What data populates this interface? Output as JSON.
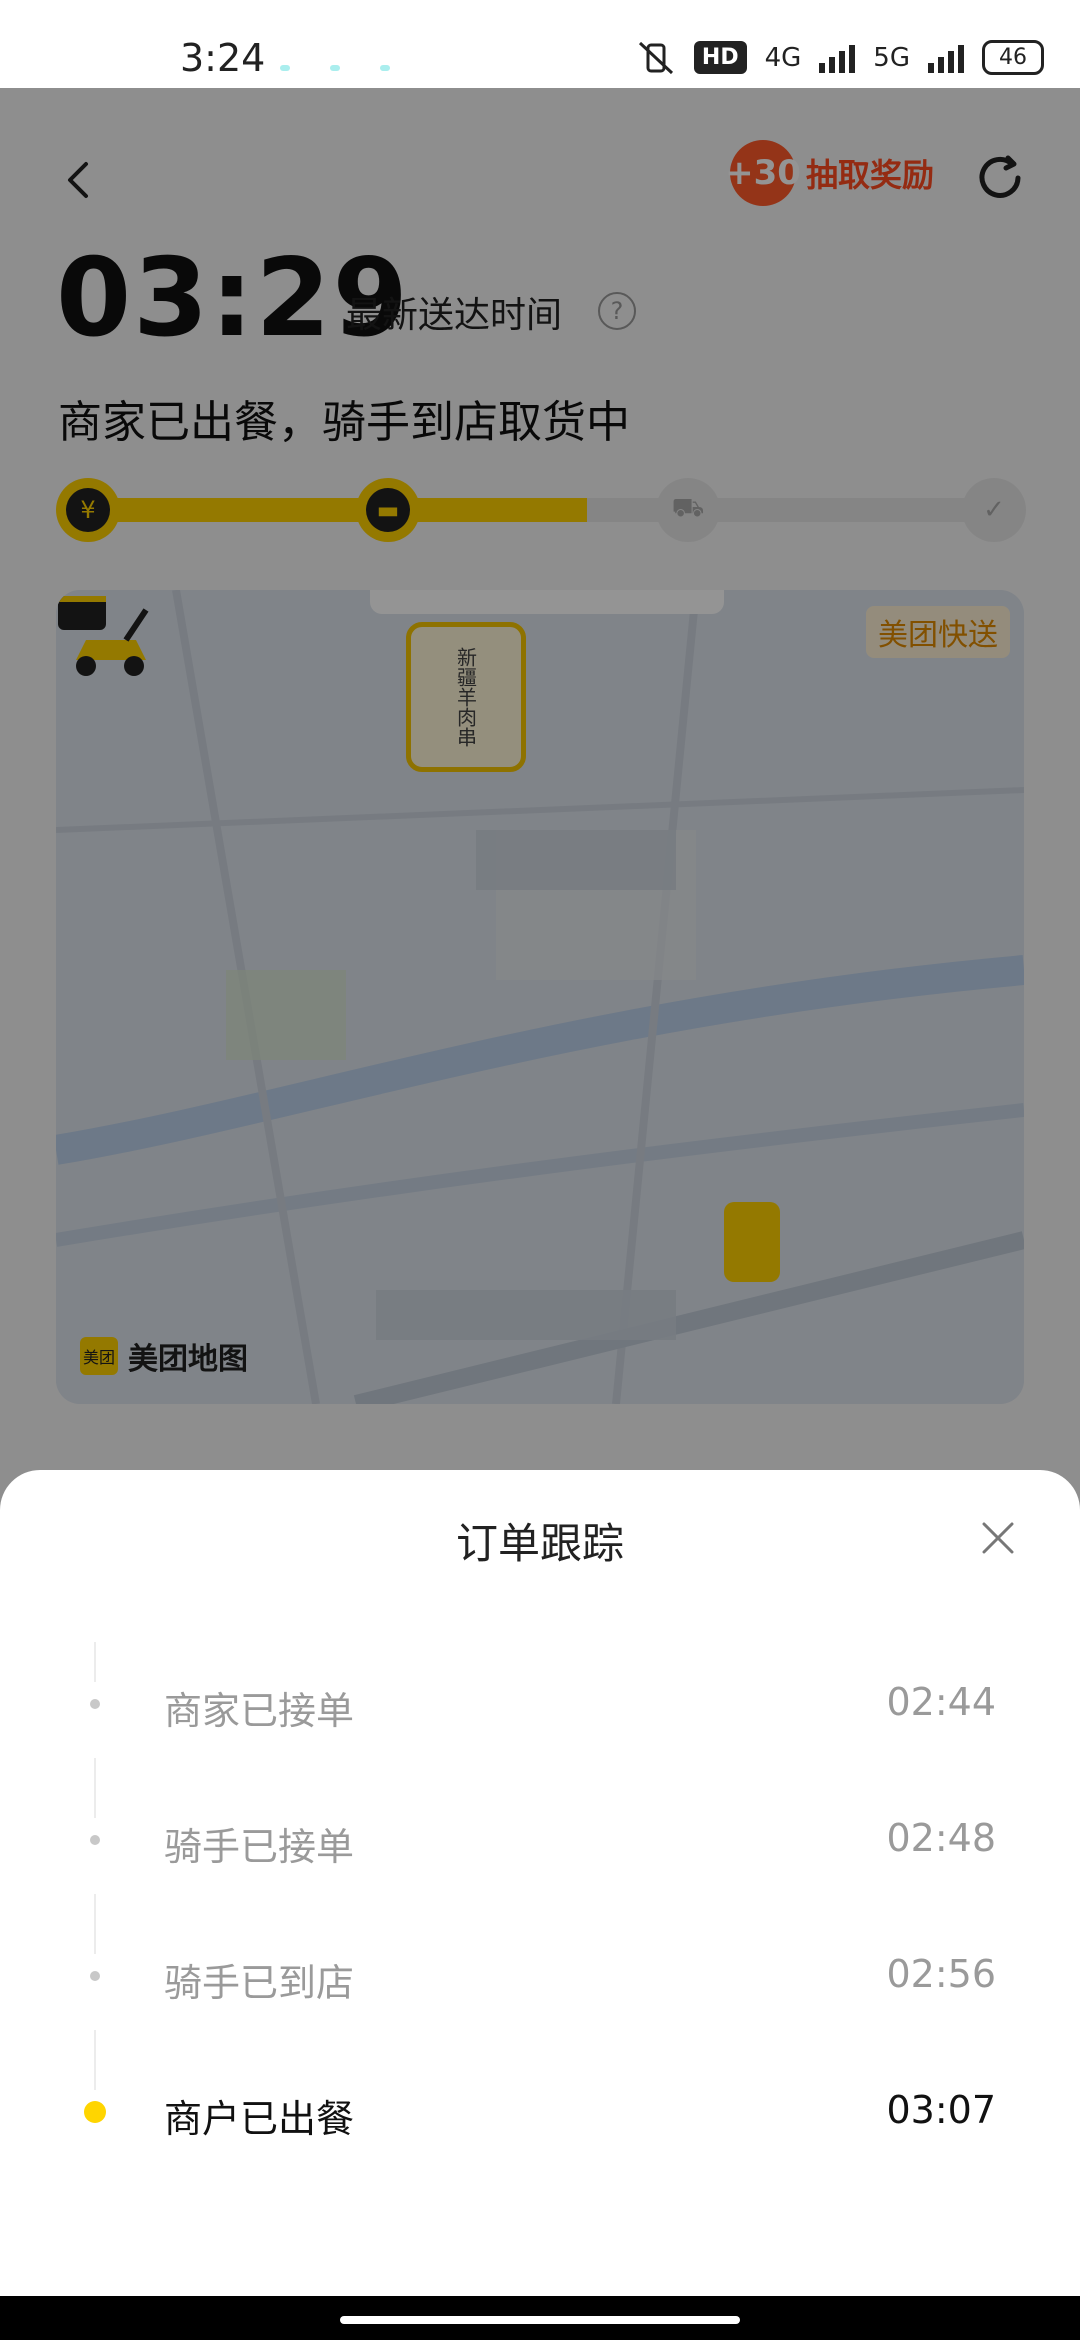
{
  "status_bar": {
    "time": "3:24",
    "network_badge": "HD",
    "net1": "4G",
    "net2": "5G",
    "battery": "46"
  },
  "header": {
    "reward_badge": "+30",
    "reward_label": "抽取奖励"
  },
  "eta": {
    "time": "03:29",
    "label": "最新送达时间",
    "help": "?"
  },
  "status_headline": "商家已出餐，骑手到店取货中",
  "progress": {
    "fraction": 0.55,
    "steps": [
      {
        "icon": "yen-icon",
        "glyph": "¥",
        "done": true
      },
      {
        "icon": "shop-icon",
        "glyph": "▬",
        "done": true
      },
      {
        "icon": "scooter-icon",
        "glyph": "⛟",
        "done": false
      },
      {
        "icon": "shield-check-icon",
        "glyph": "✓",
        "done": false
      }
    ]
  },
  "map": {
    "provider_tag": "美团快送",
    "shop_label": "新疆羊肉串",
    "logo_mark": "美团",
    "logo_text": "美团地图"
  },
  "sheet": {
    "title": "订单跟踪",
    "events": [
      {
        "label": "商家已接单",
        "time": "02:44",
        "active": false
      },
      {
        "label": "骑手已接单",
        "time": "02:48",
        "active": false
      },
      {
        "label": "骑手已到店",
        "time": "02:56",
        "active": false
      },
      {
        "label": "商户已出餐",
        "time": "03:07",
        "active": true
      }
    ]
  },
  "colors": {
    "accent_yellow": "#ffd100",
    "reward_red": "#ff4a1f",
    "inactive_text": "#9a9a9a",
    "active_text": "#111111"
  }
}
